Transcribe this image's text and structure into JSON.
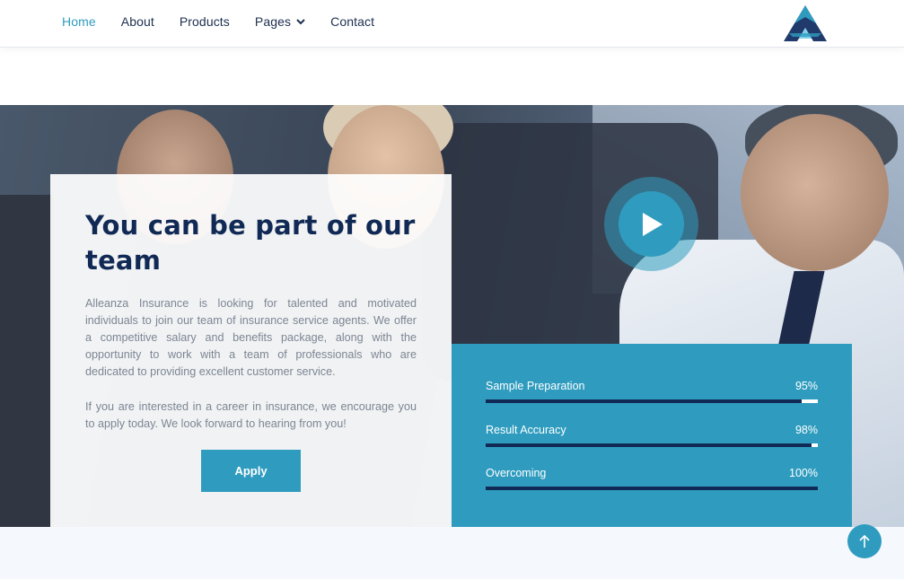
{
  "nav": {
    "items": [
      {
        "label": "Home",
        "active": true
      },
      {
        "label": "About"
      },
      {
        "label": "Products"
      },
      {
        "label": "Pages",
        "dropdown": true
      },
      {
        "label": "Contact"
      }
    ]
  },
  "hero": {
    "title": "You can be part of our team",
    "paragraph1": "Alleanza Insurance is looking for talented and motivated individuals to join our team of insurance service agents. We offer a competitive salary and benefits package, along with the opportunity to work with a team of professionals who are dedicated to providing excellent customer service.",
    "paragraph2": "If you are interested in a career in insurance, we encourage you to apply today. We look forward to hearing from you!",
    "apply_label": "Apply"
  },
  "stats": [
    {
      "label": "Sample Preparation",
      "percent_text": "95%",
      "fraction": 0.95
    },
    {
      "label": "Result Accuracy",
      "percent_text": "98%",
      "fraction": 0.98
    },
    {
      "label": "Overcoming",
      "percent_text": "100%",
      "fraction": 1.0
    }
  ],
  "colors": {
    "accent": "#2f9cbf",
    "navy": "#112a55",
    "nav_text": "#1d2f4f"
  },
  "icons": {
    "logo": "company-logo",
    "play": "play-icon",
    "to_top": "arrow-up-icon",
    "dropdown": "chevron-down-icon"
  }
}
